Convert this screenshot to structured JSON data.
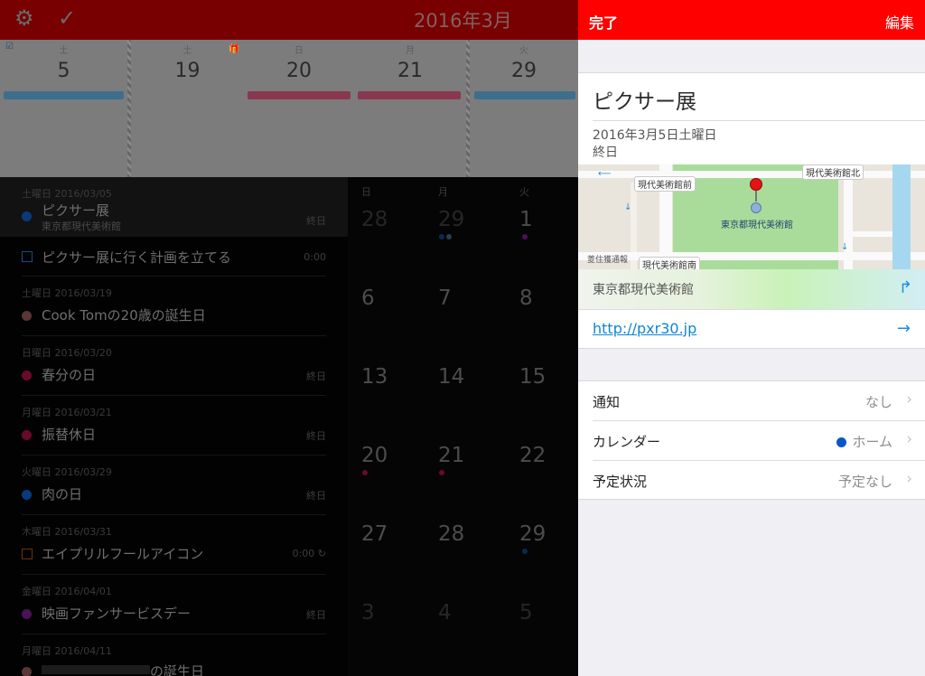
{
  "colors": {
    "accent": "#ff0000",
    "link": "#0e86d4",
    "home_calendar": "#0a56c8",
    "holiday": "#e0005b",
    "purple": "#a030b0",
    "orange": "#e06020"
  },
  "background_app": {
    "toolbar": {
      "settings_icon": "gear-icon",
      "check_icon": "checkmark-icon",
      "month_title": "2016年3月"
    },
    "day_strip": [
      {
        "weekday": "土",
        "day": "5"
      },
      {
        "weekday": "土",
        "day": "19"
      },
      {
        "weekday": "日",
        "day": "20"
      },
      {
        "weekday": "月",
        "day": "21"
      },
      {
        "weekday": "火",
        "day": "29"
      }
    ],
    "agenda": [
      {
        "header": "土曜日 2016/03/05",
        "title": "ピクサー展",
        "subtitle": "東京都現代美術館",
        "right": "終日"
      },
      {
        "header": "",
        "title": "ピクサー展に行く計画を立てる",
        "subtitle": "",
        "right": "0:00"
      },
      {
        "header": "土曜日 2016/03/19",
        "title": "Cook Tomの20歳の誕生日",
        "subtitle": "",
        "right": ""
      },
      {
        "header": "日曜日 2016/03/20",
        "title": "春分の日",
        "subtitle": "",
        "right": "終日"
      },
      {
        "header": "月曜日 2016/03/21",
        "title": "振替休日",
        "subtitle": "",
        "right": "終日"
      },
      {
        "header": "火曜日 2016/03/29",
        "title": "肉の日",
        "subtitle": "",
        "right": "終日"
      },
      {
        "header": "木曜日 2016/03/31",
        "title": "エイプリルフールアイコン",
        "subtitle": "",
        "right": "0:00 ↻"
      },
      {
        "header": "金曜日 2016/04/01",
        "title": "映画ファンサービスデー",
        "subtitle": "",
        "right": "終日"
      },
      {
        "header": "月曜日 2016/04/11",
        "title": "の誕生日",
        "subtitle": "",
        "right": ""
      }
    ],
    "calendar": {
      "weekdays": [
        "日",
        "月",
        "火"
      ],
      "rows": [
        [
          "28",
          "29",
          "1"
        ],
        [
          "6",
          "7",
          "8"
        ],
        [
          "13",
          "14",
          "15"
        ],
        [
          "20",
          "21",
          "22"
        ],
        [
          "27",
          "28",
          "29"
        ],
        [
          "3",
          "4",
          "5"
        ]
      ]
    }
  },
  "detail": {
    "done_label": "完了",
    "edit_label": "編集",
    "title": "ピクサー展",
    "date": "2016年3月5日土曜日",
    "all_day": "終日",
    "map": {
      "labels": [
        "現代美術館前",
        "現代美術館北",
        "東京都現代美術館",
        "現代美術館南",
        "菱住獲通報"
      ]
    },
    "venue": "東京都現代美術館",
    "url": "http://pxr30.jp",
    "settings": [
      {
        "label": "通知",
        "value": "なし"
      },
      {
        "label": "カレンダー",
        "value": "ホーム"
      },
      {
        "label": "予定状況",
        "value": "予定なし"
      }
    ]
  }
}
